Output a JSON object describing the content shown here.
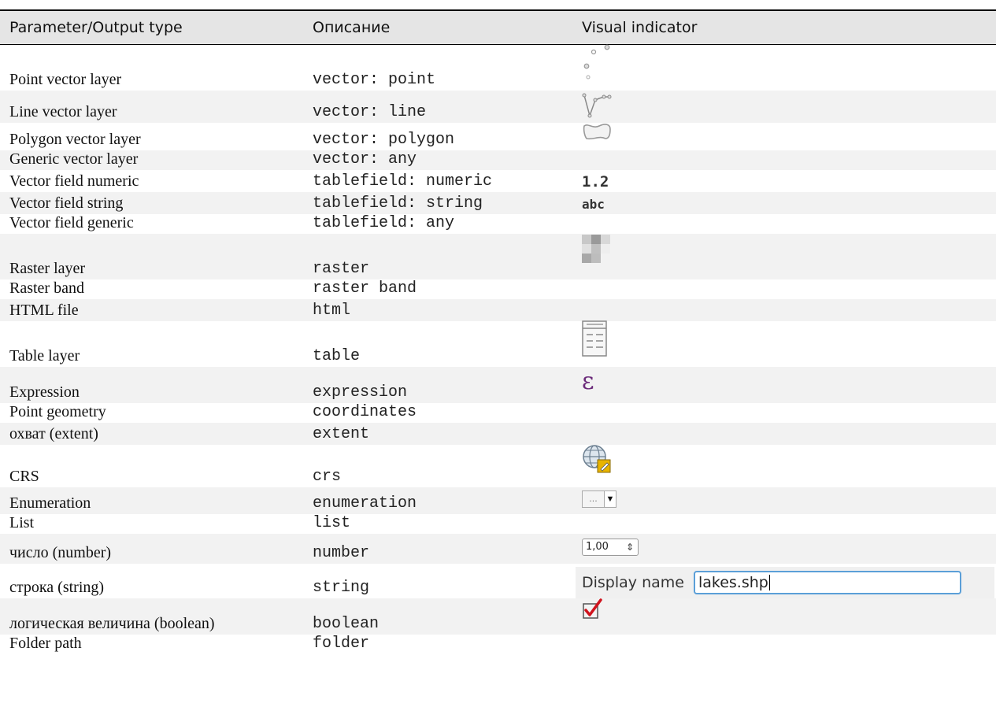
{
  "headers": {
    "col1": "Parameter/Output type",
    "col2": "Описание",
    "col3": "Visual indicator"
  },
  "rows": [
    {
      "name": "Point vector layer",
      "type": "vector: point",
      "icon": "points-icon"
    },
    {
      "name": "Line vector layer",
      "type": "vector: line",
      "icon": "line-icon"
    },
    {
      "name": "Polygon vector layer",
      "type": "vector: polygon",
      "icon": "polygon-icon"
    },
    {
      "name": "Generic vector layer",
      "type": "vector: any",
      "icon": ""
    },
    {
      "name": "Vector field numeric",
      "type": "tablefield: numeric",
      "icon": "numeric-text",
      "indicator_text": "1.2"
    },
    {
      "name": "Vector field string",
      "type": "tablefield: string",
      "icon": "string-text",
      "indicator_text": "abc"
    },
    {
      "name": "Vector field generic",
      "type": "tablefield: any",
      "icon": ""
    },
    {
      "name": "Raster layer",
      "type": "raster",
      "icon": "raster-icon"
    },
    {
      "name": "Raster band",
      "type": "raster band",
      "icon": ""
    },
    {
      "name": "HTML file",
      "type": "html",
      "icon": ""
    },
    {
      "name": "Table layer",
      "type": "table",
      "icon": "table-icon"
    },
    {
      "name": "Expression",
      "type": "expression",
      "icon": "expression-icon",
      "indicator_text": "ε"
    },
    {
      "name": "Point geometry",
      "type": "coordinates",
      "icon": ""
    },
    {
      "name": "охват (extent)",
      "type": "extent",
      "icon": ""
    },
    {
      "name": "CRS",
      "type": "crs",
      "icon": "globe-icon"
    },
    {
      "name": "Enumeration",
      "type": "enumeration",
      "icon": "combo-icon",
      "indicator_text": "...",
      "arrow": "▼"
    },
    {
      "name": "List",
      "type": "list",
      "icon": ""
    },
    {
      "name": "число (number)",
      "type": "number",
      "icon": "spinbox-icon",
      "indicator_text": "1,00",
      "arrow": "⇕"
    },
    {
      "name": "строка (string)",
      "type": "string",
      "icon": "text-input",
      "label": "Display name",
      "value": "lakes.shp"
    },
    {
      "name": "логическая величина (boolean)",
      "type": "boolean",
      "icon": "checkbox-checked-icon"
    },
    {
      "name": "Folder path",
      "type": "folder",
      "icon": ""
    }
  ],
  "colors": {
    "header_bg": "#e5e5e5",
    "row_alt_bg": "#f2f2f2",
    "expression": "#6b2a7a",
    "check": "#d0141e",
    "input_border": "#5b9fd8"
  }
}
